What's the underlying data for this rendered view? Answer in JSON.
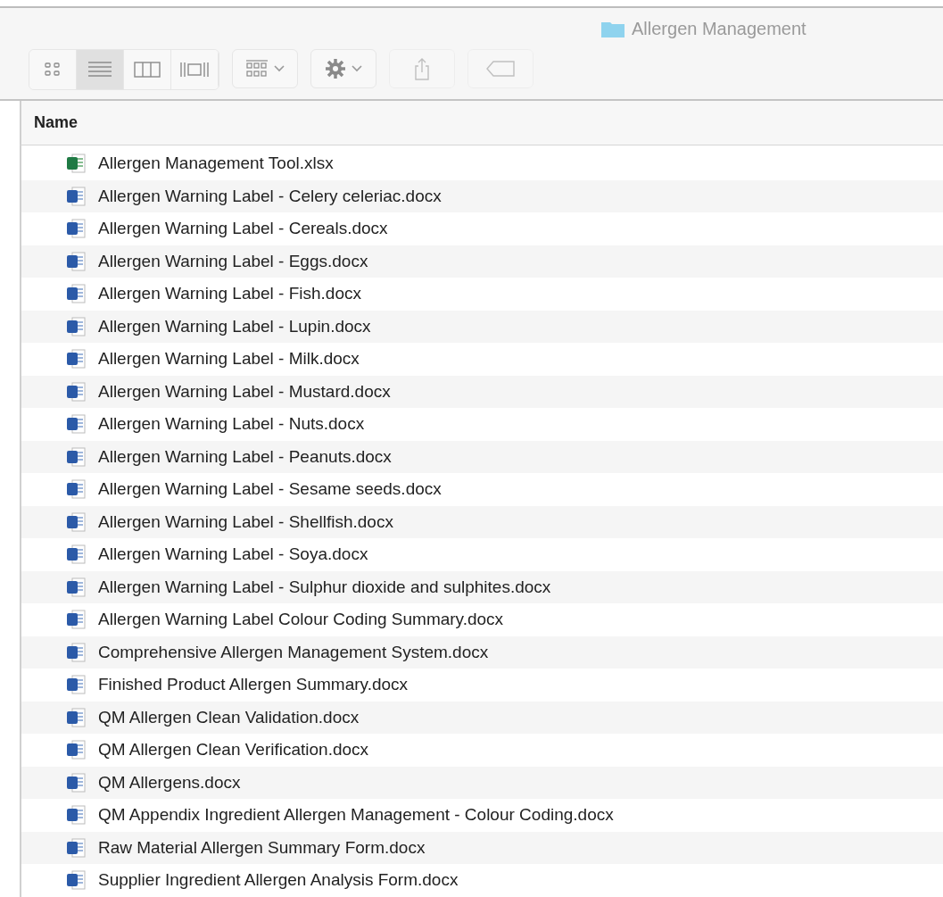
{
  "window": {
    "title": "Allergen Management"
  },
  "view_buttons": [
    {
      "kind": "icons",
      "selected": false
    },
    {
      "kind": "list",
      "selected": true
    },
    {
      "kind": "columns",
      "selected": false
    },
    {
      "kind": "gallery",
      "selected": false
    }
  ],
  "toolbar_buttons": [
    {
      "kind": "arrange",
      "disabled": false
    },
    {
      "kind": "action",
      "disabled": false
    },
    {
      "kind": "share",
      "disabled": true
    },
    {
      "kind": "tag",
      "disabled": true
    }
  ],
  "table": {
    "columns": [
      "Name"
    ],
    "rows": [
      {
        "name": "Allergen Management Tool.xlsx",
        "kind": "xlsx"
      },
      {
        "name": "Allergen Warning Label - Celery celeriac.docx",
        "kind": "docx"
      },
      {
        "name": "Allergen Warning Label - Cereals.docx",
        "kind": "docx"
      },
      {
        "name": "Allergen Warning Label - Eggs.docx",
        "kind": "docx"
      },
      {
        "name": "Allergen Warning Label - Fish.docx",
        "kind": "docx"
      },
      {
        "name": "Allergen Warning Label - Lupin.docx",
        "kind": "docx"
      },
      {
        "name": "Allergen Warning Label - Milk.docx",
        "kind": "docx"
      },
      {
        "name": "Allergen Warning Label - Mustard.docx",
        "kind": "docx"
      },
      {
        "name": "Allergen Warning Label - Nuts.docx",
        "kind": "docx"
      },
      {
        "name": "Allergen Warning Label - Peanuts.docx",
        "kind": "docx"
      },
      {
        "name": "Allergen Warning Label - Sesame seeds.docx",
        "kind": "docx"
      },
      {
        "name": "Allergen Warning Label - Shellfish.docx",
        "kind": "docx"
      },
      {
        "name": "Allergen Warning Label - Soya.docx",
        "kind": "docx"
      },
      {
        "name": "Allergen Warning Label - Sulphur dioxide and sulphites.docx",
        "kind": "docx"
      },
      {
        "name": "Allergen Warning Label Colour Coding Summary.docx",
        "kind": "docx"
      },
      {
        "name": "Comprehensive Allergen Management System.docx",
        "kind": "docx"
      },
      {
        "name": "Finished Product Allergen Summary.docx",
        "kind": "docx"
      },
      {
        "name": "QM Allergen Clean Validation.docx",
        "kind": "docx"
      },
      {
        "name": "QM Allergen Clean Verification.docx",
        "kind": "docx"
      },
      {
        "name": "QM Allergens.docx",
        "kind": "docx"
      },
      {
        "name": "QM Appendix Ingredient Allergen Management - Colour Coding.docx",
        "kind": "docx"
      },
      {
        "name": "Raw Material Allergen Summary Form.docx",
        "kind": "docx"
      },
      {
        "name": "Supplier Ingredient Allergen Analysis Form.docx",
        "kind": "docx"
      }
    ]
  }
}
